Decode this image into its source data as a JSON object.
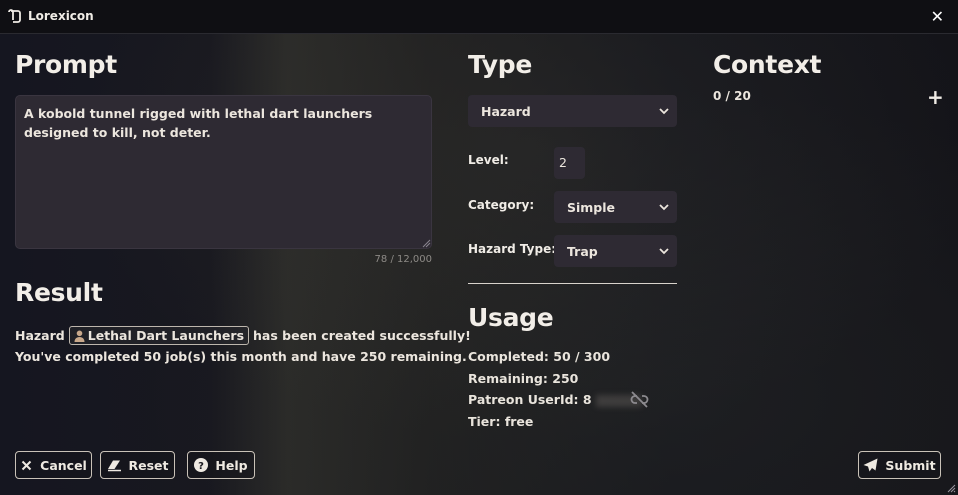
{
  "app": {
    "title": "Lorexicon"
  },
  "prompt": {
    "heading": "Prompt",
    "value": "A kobold tunnel rigged with lethal dart launchers designed to kill, not deter.",
    "counter": "78 / 12,000"
  },
  "result": {
    "heading": "Result",
    "prefix": "Hazard",
    "entity_name": "Lethal Dart Launchers",
    "suffix": "has been created successfully!",
    "line2": "You've completed 50 job(s) this month and have 250 remaining."
  },
  "type": {
    "heading": "Type",
    "selected": "Hazard",
    "level_label": "Level:",
    "level_value": "2",
    "category_label": "Category:",
    "category_value": "Simple",
    "hazard_type_label": "Hazard Type:",
    "hazard_type_value": "Trap"
  },
  "usage": {
    "heading": "Usage",
    "completed_label": "Completed:",
    "completed_value": "50 / 300",
    "remaining_label": "Remaining:",
    "remaining_value": "250",
    "patreon_label": "Patreon UserId:",
    "patreon_value": "8",
    "tier_label": "Tier:",
    "tier_value": "free"
  },
  "context": {
    "heading": "Context",
    "count": "0 / 20"
  },
  "buttons": {
    "cancel": "Cancel",
    "reset": "Reset",
    "help": "Help",
    "submit": "Submit"
  },
  "icons": {
    "app": "scroll-icon",
    "close": "close-icon",
    "plus": "plus-icon",
    "person": "person-icon",
    "unlink": "unlink-icon",
    "cancel": "x-icon",
    "reset": "eraser-icon",
    "help": "question-icon",
    "submit": "paper-plane-icon"
  }
}
